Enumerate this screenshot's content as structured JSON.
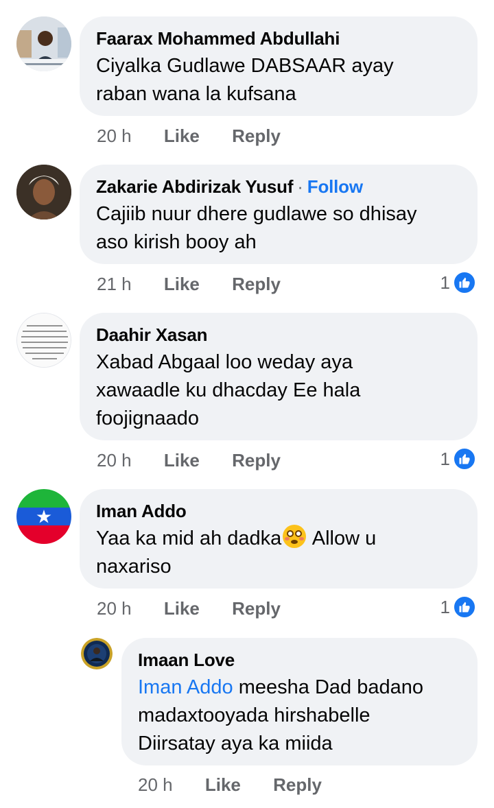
{
  "comments": [
    {
      "author": "Faarax Mohammed Abdullahi",
      "line1": "Ciyalka Gudlawe DABSAAR ayay",
      "line2": "raban wana la kufsana",
      "time": "20 h",
      "like": "Like",
      "reply": "Reply"
    },
    {
      "author": "Zakarie Abdirizak Yusuf",
      "follow": "Follow",
      "line1": "Cajiib nuur dhere gudlawe so dhisay",
      "line2": "aso kirish booy ah",
      "time": "21 h",
      "like": "Like",
      "reply": "Reply",
      "reactions": "1"
    },
    {
      "author": "Daahir Xasan",
      "line1": "Xabad Abgaal loo weday aya",
      "line2": "xawaadle ku dhacday Ee hala",
      "line3": "foojignaado",
      "time": "20 h",
      "like": "Like",
      "reply": "Reply",
      "reactions": "1"
    },
    {
      "author": "Iman Addo",
      "line1a": "Yaa ka mid ah dadka",
      "line1b": " Allow u",
      "line2": "naxariso",
      "time": "20 h",
      "like": "Like",
      "reply": "Reply",
      "reactions": "1"
    },
    {
      "author": "Imaan Love",
      "mention": "Iman Addo",
      "line1": " meesha Dad badano",
      "line2": "madaxtooyada hirshabelle",
      "line3": "Diirsatay aya ka miida",
      "time": "20 h",
      "like": "Like",
      "reply": "Reply"
    }
  ],
  "colors": {
    "accent": "#1877f2",
    "bubble": "#f0f2f5",
    "meta": "#65676b"
  },
  "icons": {
    "reaction": "thumbs-up-icon",
    "emoji": "flushed-face-emoji"
  }
}
